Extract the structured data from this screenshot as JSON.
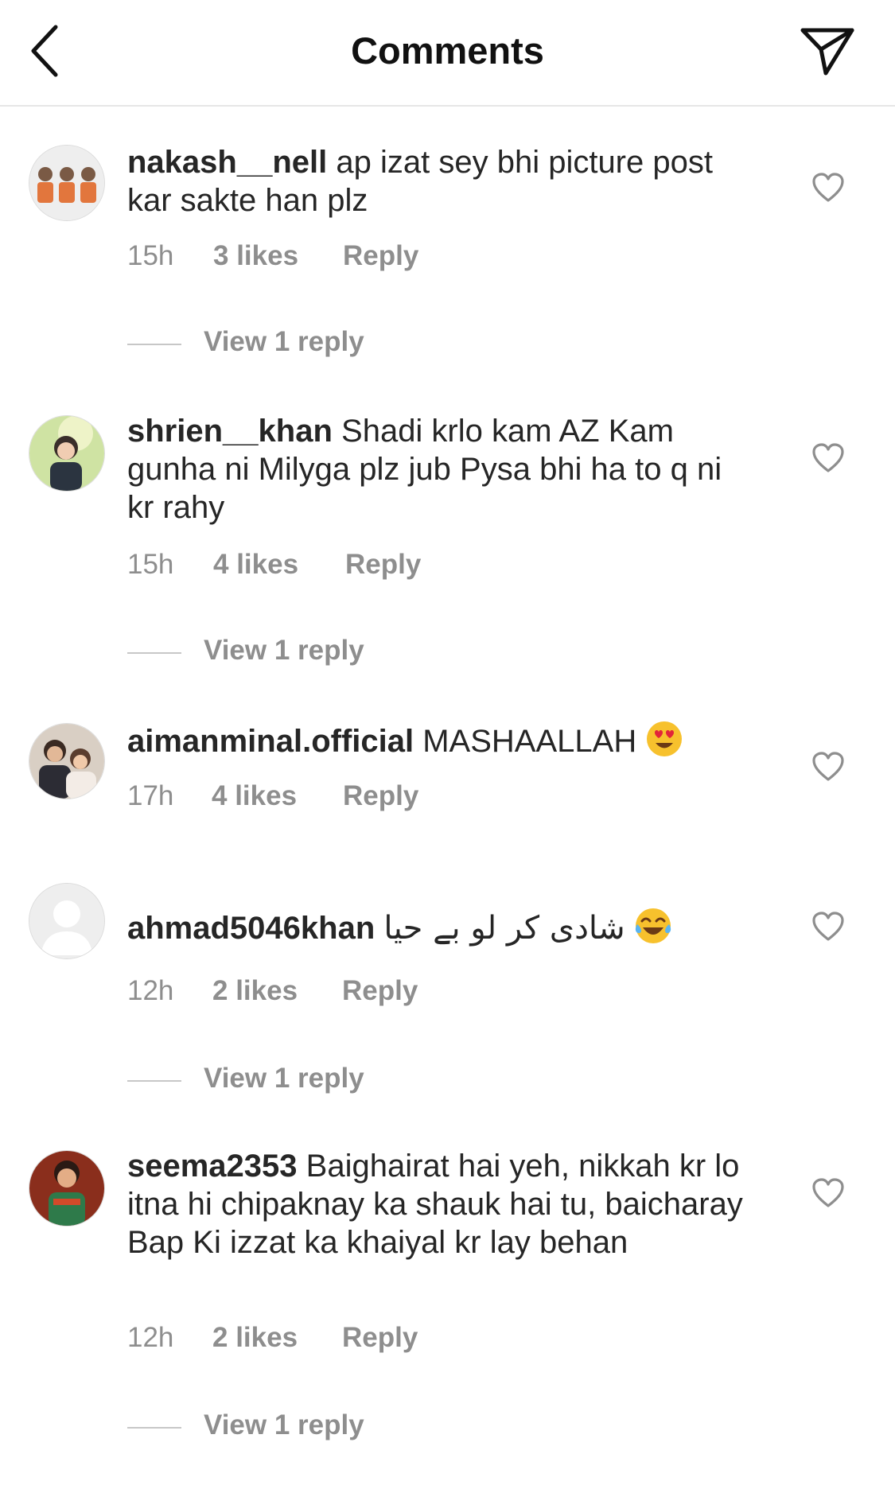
{
  "header": {
    "title": "Comments",
    "back_icon": "chevron-left-icon",
    "send_icon": "paper-plane-icon"
  },
  "colors": {
    "text": "#262626",
    "meta": "#8e8e8e",
    "divider": "#e6e6e6",
    "emoji_yellow": "#f7c12d"
  },
  "comments": [
    {
      "username": "nakash__nell",
      "text": "ap izat sey bhi picture post kar sakte han plz",
      "time": "15h",
      "likes": "3 likes",
      "reply": "Reply",
      "view_replies": "View 1 reply"
    },
    {
      "username": "shrien__khan",
      "text": "Shadi krlo kam AZ Kam gunha ni Milyga plz jub Pysa bhi ha to q ni kr rahy",
      "time": "15h",
      "likes": "4 likes",
      "reply": "Reply",
      "view_replies": "View 1 reply"
    },
    {
      "username": "aimanminal.official",
      "text": "MASHAALLAH",
      "emoji": "heart-eyes-emoji",
      "time": "17h",
      "likes": "4 likes",
      "reply": "Reply"
    },
    {
      "username": "ahmad5046khan",
      "text": "شادی کر لو بے حیا",
      "emoji": "laughing-tears-emoji",
      "time": "12h",
      "likes": "2 likes",
      "reply": "Reply",
      "view_replies": "View 1 reply"
    },
    {
      "username": "seema2353",
      "text": "Baighairat hai yeh, nikkah kr lo itna hi chipaknay ka shauk hai tu, baicharay Bap Ki izzat ka khaiyal kr lay behan",
      "time": "12h",
      "likes": "2 likes",
      "reply": "Reply",
      "view_replies": "View 1 reply"
    }
  ]
}
